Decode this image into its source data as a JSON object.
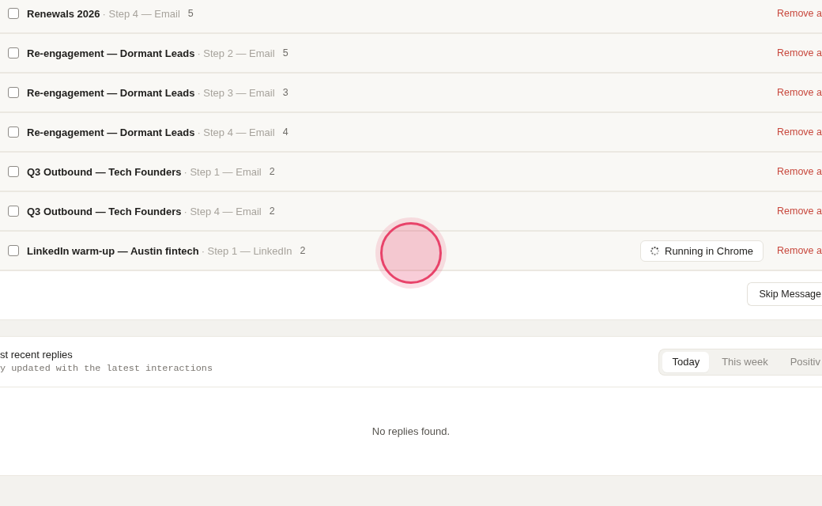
{
  "queue": {
    "rows": [
      {
        "campaign": "Renewals 2026",
        "step": "· Step 4 — Email",
        "count": "5",
        "checked": false,
        "action": "Remove a"
      },
      {
        "campaign": "Re-engagement — Dormant Leads",
        "step": "· Step 2 — Email",
        "count": "5",
        "checked": false,
        "action": "Remove a"
      },
      {
        "campaign": "Re-engagement — Dormant Leads",
        "step": "· Step 3 — Email",
        "count": "3",
        "checked": false,
        "action": "Remove a"
      },
      {
        "campaign": "Re-engagement — Dormant Leads",
        "step": "· Step 4 — Email",
        "count": "4",
        "checked": false,
        "action": "Remove a"
      },
      {
        "campaign": "Q3 Outbound — Tech Founders",
        "step": "· Step 1 — Email",
        "count": "2",
        "checked": false,
        "action": "Remove a"
      },
      {
        "campaign": "Q3 Outbound — Tech Founders",
        "step": "· Step 4 — Email",
        "count": "2",
        "checked": false,
        "action": "Remove a"
      },
      {
        "campaign": "LinkedIn warm-up — Austin fintech",
        "step": "· Step 1 — LinkedIn",
        "count": "2",
        "checked": false,
        "status": "Running in Chrome",
        "action": "Remove a"
      }
    ],
    "skip_button": "Skip Message"
  },
  "replies": {
    "title": "st recent replies",
    "subtitle": "y updated with the latest interactions",
    "tabs": [
      {
        "label": "Today",
        "selected": true
      },
      {
        "label": "This week",
        "selected": false
      },
      {
        "label": "Positiv",
        "selected": false
      }
    ],
    "empty_message": "No replies found."
  },
  "click_indicator": true
}
